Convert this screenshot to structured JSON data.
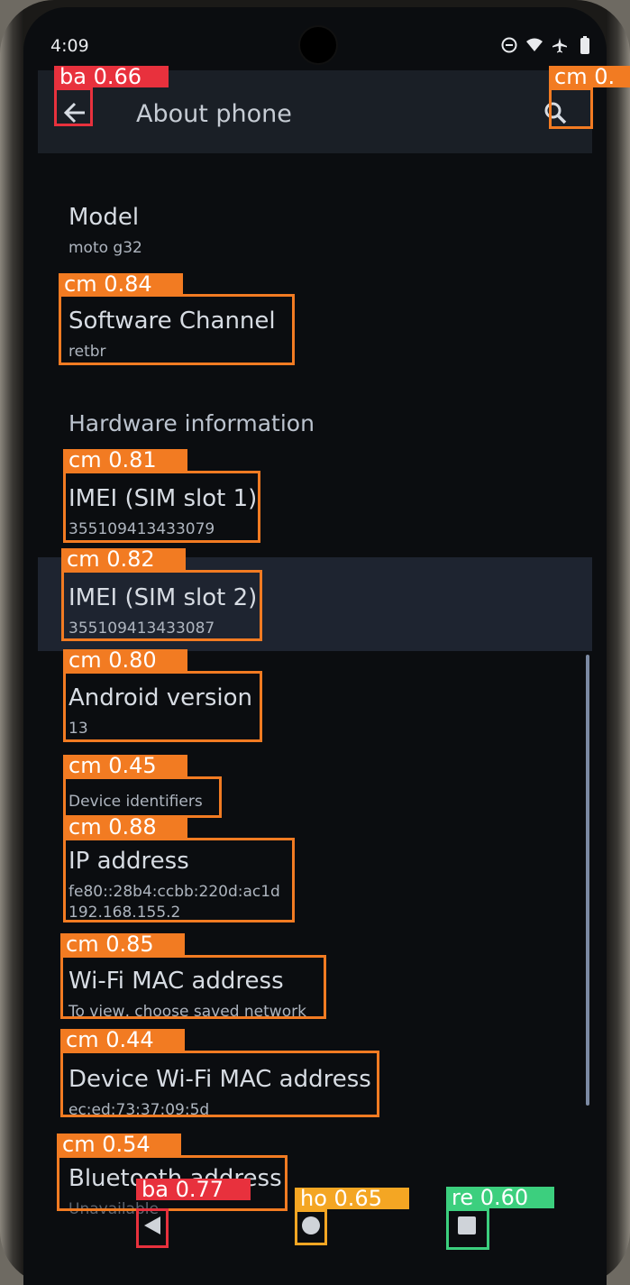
{
  "status_bar": {
    "time": "4:09"
  },
  "app_bar": {
    "title": "About phone"
  },
  "items": {
    "model": {
      "label": "Model",
      "value": "moto g32"
    },
    "software_channel": {
      "label": "Software Channel",
      "value": "retbr"
    },
    "hardware_header": "Hardware information",
    "imei1": {
      "label": "IMEI (SIM slot 1)",
      "value": "355109413433079"
    },
    "imei2": {
      "label": "IMEI (SIM slot 2)",
      "value": "355109413433087"
    },
    "android_version": {
      "label": "Android version",
      "value": "13"
    },
    "device_identifiers": {
      "label": "Device identifiers"
    },
    "ip_address": {
      "label": "IP address",
      "value_line1": "fe80::28b4:ccbb:220d:ac1d",
      "value_line2": "192.168.155.2"
    },
    "wifi_mac": {
      "label": "Wi-Fi MAC address",
      "value": "To view, choose saved network"
    },
    "device_wifi_mac": {
      "label": "Device Wi-Fi MAC address",
      "value": "ec:ed:73:37:09:5d"
    },
    "bluetooth": {
      "label": "Bluetooth address",
      "value": "Unavailable"
    }
  },
  "detections": [
    {
      "tag": "ba 0.66",
      "color": "#e8313d"
    },
    {
      "tag": "cm 0.",
      "color": "#f27b22"
    },
    {
      "tag": "cm 0.84",
      "color": "#f27b22"
    },
    {
      "tag": "cm 0.81",
      "color": "#f27b22"
    },
    {
      "tag": "cm 0.82",
      "color": "#f27b22"
    },
    {
      "tag": "cm 0.80",
      "color": "#f27b22"
    },
    {
      "tag": "cm 0.45",
      "color": "#f27b22"
    },
    {
      "tag": "cm 0.88",
      "color": "#f27b22"
    },
    {
      "tag": "cm 0.85",
      "color": "#f27b22"
    },
    {
      "tag": "cm 0.44",
      "color": "#f27b22"
    },
    {
      "tag": "cm 0.54",
      "color": "#f27b22"
    },
    {
      "tag": "ba 0.77",
      "color": "#e8313d"
    },
    {
      "tag": "ho 0.65",
      "color": "#f4a623"
    },
    {
      "tag": "re 0.60",
      "color": "#3ccf7e"
    }
  ],
  "colors": {
    "background": "#0b0d10",
    "app_bar": "#1a1f26",
    "highlight": "#1e2430"
  }
}
